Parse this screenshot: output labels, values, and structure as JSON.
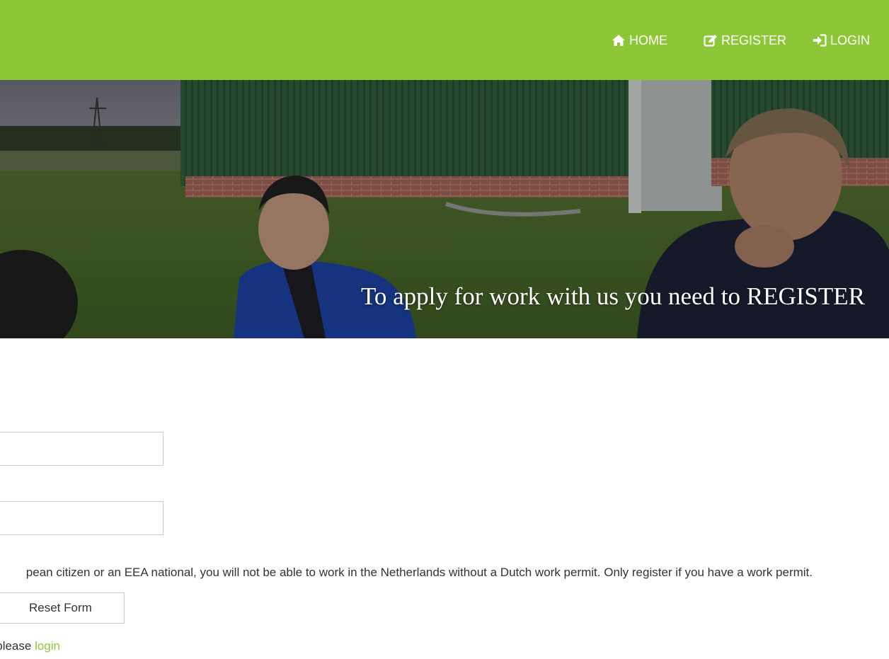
{
  "nav": {
    "items": [
      {
        "label": "HOME",
        "icon": "home-icon"
      },
      {
        "label": "REGISTER",
        "icon": "edit-icon"
      },
      {
        "label": "LOGIN",
        "icon": "sign-in-icon"
      }
    ]
  },
  "hero": {
    "title": "To apply for work with us you need to REGISTER"
  },
  "form": {
    "field_1_value": "",
    "field_2_value": "",
    "notice": "pean citizen or an EEA national, you will not be able to work in the Netherlands without a Dutch work permit. Only register if you have a work permit.",
    "reset_label": "Reset Form",
    "login_prefix": "please ",
    "login_link": "login"
  },
  "colors": {
    "brand_green": "#8dc737",
    "text": "#333333"
  }
}
